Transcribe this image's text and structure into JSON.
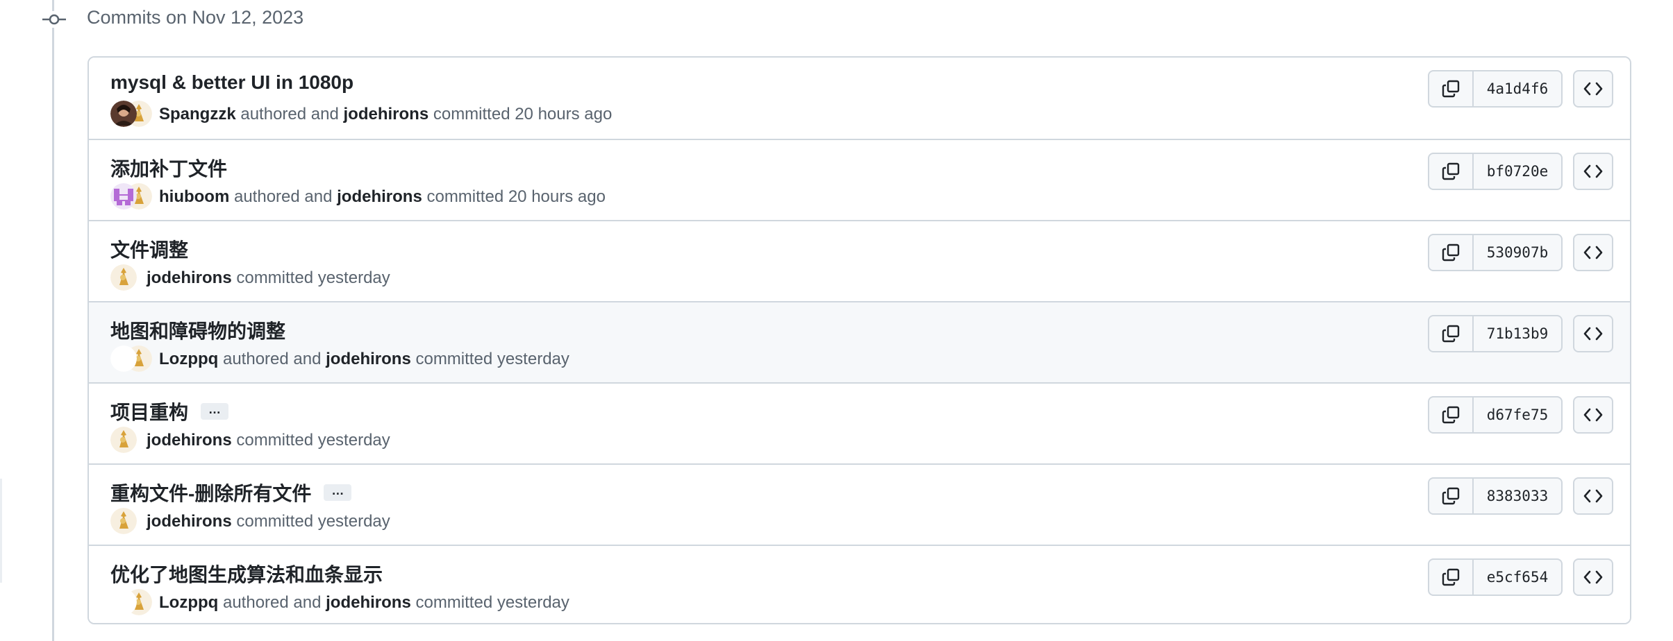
{
  "group": {
    "title": "Commits on Nov 12, 2023"
  },
  "commits": [
    {
      "message": "mysql & better UI in 1080p",
      "has_more": false,
      "author": "Spangzzk",
      "authored_text": "authored and",
      "committer": "jodehirons",
      "committed_text": "committed 20 hours ago",
      "author_avatar": "photo-avatar",
      "sha": "4a1d4f6"
    },
    {
      "message": "添加补丁文件",
      "has_more": false,
      "author": "hiuboom",
      "authored_text": "authored and",
      "committer": "jodehirons",
      "committed_text": "committed 20 hours ago",
      "author_avatar": "identicon-avatar",
      "sha": "bf0720e"
    },
    {
      "message": "文件调整",
      "has_more": false,
      "author": "",
      "authored_text": "",
      "committer": "jodehirons",
      "committed_text": "committed yesterday",
      "author_avatar": "",
      "sha": "530907b"
    },
    {
      "message": "地图和障碍物的调整",
      "has_more": false,
      "author": "Lozppq",
      "authored_text": "authored and",
      "committer": "jodehirons",
      "committed_text": "committed yesterday",
      "author_avatar": "blank-avatar",
      "sha": "71b13b9"
    },
    {
      "message": "项目重构",
      "has_more": true,
      "author": "",
      "authored_text": "",
      "committer": "jodehirons",
      "committed_text": "committed yesterday",
      "author_avatar": "",
      "sha": "d67fe75"
    },
    {
      "message": "重构文件-删除所有文件",
      "has_more": true,
      "author": "",
      "authored_text": "",
      "committer": "jodehirons",
      "committed_text": "committed yesterday",
      "author_avatar": "",
      "sha": "8383033"
    },
    {
      "message": "优化了地图生成算法和血条显示",
      "has_more": false,
      "author": "Lozppq",
      "authored_text": "authored and",
      "committer": "jodehirons",
      "committed_text": "committed yesterday",
      "author_avatar": "blank-avatar",
      "sha": "e5cf654"
    }
  ],
  "icons": {
    "timeline": "git-commit-icon",
    "copy": "copy-icon",
    "browse": "code-icon",
    "more": "ellipsis-icon"
  },
  "ellipsis_label": "…",
  "colors": {
    "border": "#d0d7de",
    "muted_text": "#59636e",
    "highlight_row": "#f6f8fa",
    "button_bg": "#f6f8fa"
  }
}
